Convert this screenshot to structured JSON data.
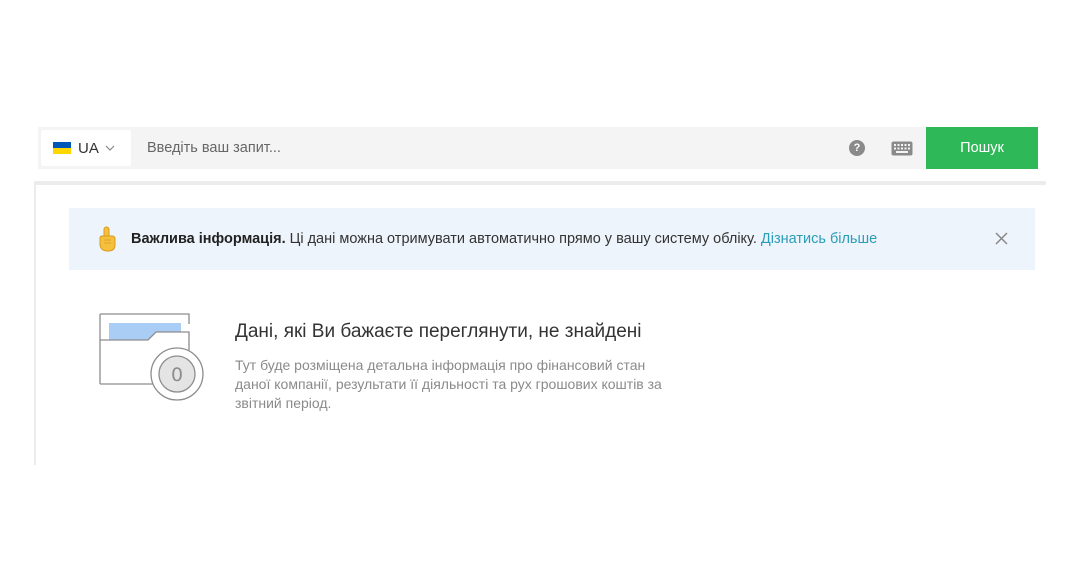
{
  "search": {
    "language": "UA",
    "placeholder": "Введіть ваш запит...",
    "value": "",
    "button_label": "Пошук",
    "help_icon": "question-circle-icon",
    "keyboard_icon": "keyboard-icon"
  },
  "banner": {
    "title": "Важлива інформація.",
    "text": " Ці дані можна отримувати автоматично прямо у вашу систему обліку. ",
    "link": "Дізнатись більше",
    "icon": "pointing-hand-icon"
  },
  "empty_state": {
    "title": "Дані, які Ви бажаєте переглянути, не знайдені",
    "description": "Тут буде розміщена детальна інформація про фінансовий стан даної компанії, результати її діяльності та рух грошових коштів за звітний період.",
    "badge_number": "0"
  },
  "colors": {
    "accent_green": "#2eb857",
    "link_blue": "#2a9db8",
    "banner_bg": "#eef4fb"
  }
}
